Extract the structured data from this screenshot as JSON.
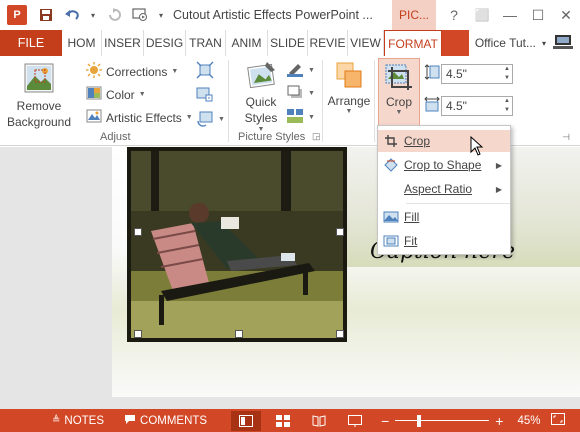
{
  "window": {
    "app_icon_label": "P",
    "title": "Cutout Artistic Effects PowerPoint ...",
    "contextual_tab": "PIC...",
    "controls": [
      "?",
      "⬜",
      "—",
      "☐",
      "✕"
    ]
  },
  "tabs": {
    "file": "FILE",
    "items": [
      "HOM",
      "INSER",
      "DESIG",
      "TRAN",
      "ANIM",
      "SLIDE",
      "REVIE",
      "VIEW"
    ],
    "active": "FORMAT",
    "account": "Office Tut..."
  },
  "ribbon": {
    "remove_background": "Remove Background",
    "corrections": "Corrections",
    "color": "Color",
    "artistic_effects": "Artistic Effects",
    "adjust_group": "Adjust",
    "quick_styles": "Quick Styles",
    "picture_styles_group": "Picture Styles",
    "arrange": "Arrange",
    "crop": "Crop",
    "height_value": "4.5\"",
    "width_value": "4.5\""
  },
  "crop_menu": {
    "items": [
      "Crop",
      "Crop to Shape",
      "Aspect Ratio",
      "Fill",
      "Fit"
    ],
    "highlighted": "Crop"
  },
  "slide": {
    "caption": "Caption here"
  },
  "statusbar": {
    "notes": "NOTES",
    "comments": "COMMENTS",
    "zoom": "45%"
  },
  "colors": {
    "accent": "#d24726",
    "file_tab": "#c43e1c",
    "highlight": "#f6d7cc"
  }
}
